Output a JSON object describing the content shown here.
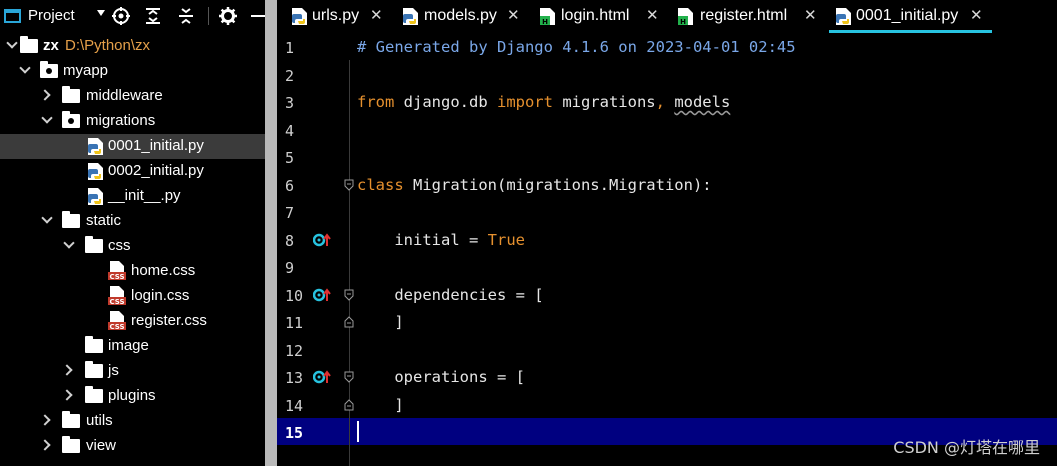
{
  "project_panel": {
    "title": "Project",
    "tree": [
      {
        "label": "zx",
        "path": "D:\\Python\\zx",
        "type": "folder",
        "expanded": true
      },
      {
        "label": "myapp",
        "type": "package",
        "expanded": true
      },
      {
        "label": "middleware",
        "type": "folder",
        "expanded": false
      },
      {
        "label": "migrations",
        "type": "package",
        "expanded": true
      },
      {
        "label": "0001_initial.py",
        "type": "python",
        "selected": true
      },
      {
        "label": "0002_initial.py",
        "type": "python"
      },
      {
        "label": "__init__.py",
        "type": "python"
      },
      {
        "label": "static",
        "type": "folder",
        "expanded": true
      },
      {
        "label": "css",
        "type": "folder",
        "expanded": true
      },
      {
        "label": "home.css",
        "type": "css"
      },
      {
        "label": "login.css",
        "type": "css"
      },
      {
        "label": "register.css",
        "type": "css"
      },
      {
        "label": "image",
        "type": "folder"
      },
      {
        "label": "js",
        "type": "folder",
        "expanded": false
      },
      {
        "label": "plugins",
        "type": "folder",
        "expanded": false
      },
      {
        "label": "utils",
        "type": "folder",
        "expanded": false
      },
      {
        "label": "view",
        "type": "folder",
        "expanded": false
      }
    ]
  },
  "tabs": [
    {
      "label": "urls.py",
      "close": "✕",
      "type": "python"
    },
    {
      "label": "models.py",
      "close": "✕",
      "type": "python"
    },
    {
      "label": "login.html",
      "close": "✕",
      "type": "html"
    },
    {
      "label": "register.html",
      "close": "✕",
      "type": "html"
    },
    {
      "label": "0001_initial.py",
      "close": "✕",
      "type": "python",
      "active": true
    }
  ],
  "editor": {
    "line_numbers": [
      "1",
      "2",
      "3",
      "4",
      "5",
      "6",
      "7",
      "8",
      "9",
      "10",
      "11",
      "12",
      "13",
      "14",
      "15"
    ],
    "current_line": "15",
    "lines": [
      [
        {
          "t": "# Generated by Django 4.1.6 on 2023-04-01 02:45",
          "c": "comment"
        }
      ],
      [],
      [
        {
          "t": "from",
          "c": "kw"
        },
        {
          "t": " django.db ",
          "c": "id"
        },
        {
          "t": "import",
          "c": "kw"
        },
        {
          "t": " migrations",
          "c": "id"
        },
        {
          "t": ", ",
          "c": "kw"
        },
        {
          "t": "models",
          "c": "unused"
        }
      ],
      [],
      [],
      [
        {
          "t": "class",
          "c": "kw"
        },
        {
          "t": " Migration(migrations.Migration):",
          "c": "id"
        }
      ],
      [],
      [
        {
          "t": "    initial = ",
          "c": "id"
        },
        {
          "t": "True",
          "c": "const"
        }
      ],
      [],
      [
        {
          "t": "    dependencies = [",
          "c": "id"
        }
      ],
      [
        {
          "t": "    ]",
          "c": "id"
        }
      ],
      [],
      [
        {
          "t": "    operations = [",
          "c": "id"
        }
      ],
      [
        {
          "t": "    ]",
          "c": "id"
        }
      ],
      []
    ]
  },
  "watermark": "CSDN @灯塔在哪里",
  "colors": {
    "accent": "#27c3e0",
    "current_line": "#000080",
    "keyword": "#e5902e",
    "comment": "#7aa7e8",
    "path": "#e5a04a"
  }
}
